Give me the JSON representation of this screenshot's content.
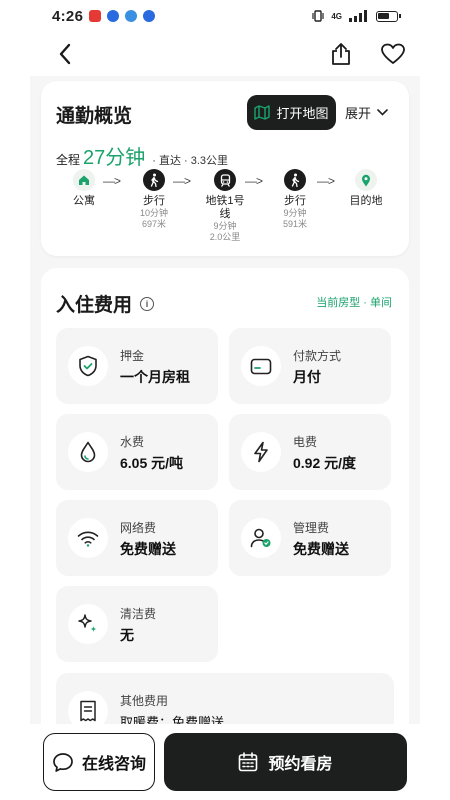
{
  "status_bar": {
    "time": "4:26",
    "network": "4G"
  },
  "commute": {
    "title": "通勤概览",
    "map_button": "打开地图",
    "expand_button": "展开",
    "summary_prefix": "全程",
    "duration": "27分钟",
    "summary_meta": "· 直达 · 3.3公里",
    "steps": [
      {
        "label": "公寓",
        "icon": "home-icon"
      },
      {
        "label": "步行",
        "sub1": "10分钟",
        "sub2": "697米",
        "icon": "walk-icon"
      },
      {
        "label": "地铁1号线",
        "sub1": "9分钟",
        "sub2": "2.0公里",
        "icon": "subway-icon"
      },
      {
        "label": "步行",
        "sub1": "9分钟",
        "sub2": "591米",
        "icon": "walk-icon"
      },
      {
        "label": "目的地",
        "icon": "location-pin-icon"
      }
    ],
    "arrow": "—>"
  },
  "fees": {
    "title": "入住费用",
    "room_tag": "当前房型 · 单间",
    "items": [
      {
        "label": "押金",
        "value": "一个月房租",
        "icon": "shield-check-icon"
      },
      {
        "label": "付款方式",
        "value": "月付",
        "icon": "card-icon"
      },
      {
        "label": "水费",
        "value": "6.05 元/吨",
        "icon": "water-drop-icon"
      },
      {
        "label": "电费",
        "value": "0.92 元/度",
        "icon": "lightning-icon"
      },
      {
        "label": "网络费",
        "value": "免费赠送",
        "icon": "wifi-icon"
      },
      {
        "label": "管理费",
        "value": "免费赠送",
        "icon": "user-manage-icon"
      },
      {
        "label": "清洁费",
        "value": "无",
        "icon": "sparkle-icon"
      }
    ],
    "other": {
      "label": "其他费用",
      "value": "取暖费：免费赠送",
      "icon": "receipt-icon"
    }
  },
  "bottom": {
    "consult": "在线咨询",
    "book": "预约看房"
  },
  "colors": {
    "accent": "#1aa36b",
    "dark": "#1d1f1e"
  }
}
